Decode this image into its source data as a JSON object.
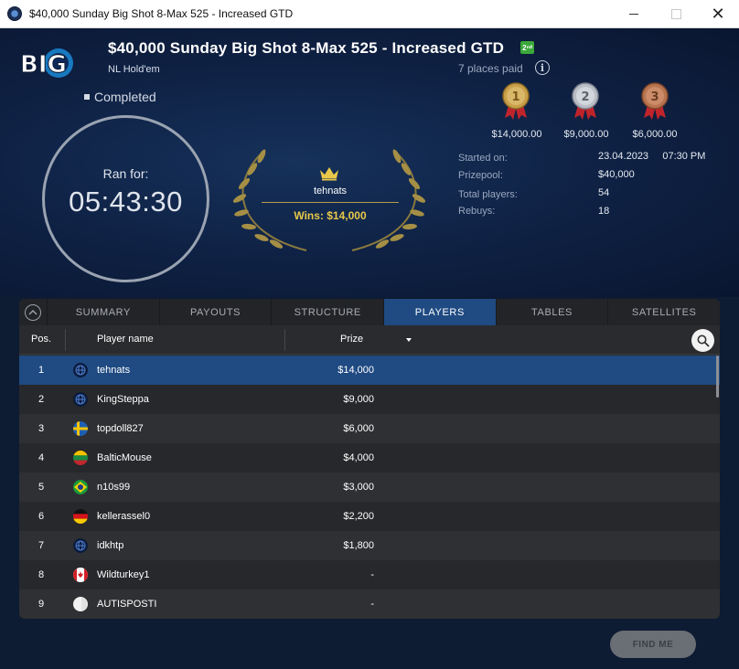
{
  "window": {
    "title": "$40,000 Sunday Big Shot 8-Max 525 - Increased GTD",
    "close_glyph": "✕"
  },
  "header": {
    "logo_text": "BIG",
    "title": "$40,000 Sunday Big Shot 8-Max 525 - Increased GTD",
    "badge": "2ⁿᵈ",
    "game_type": "NL Hold'em",
    "places_paid": "7 places paid",
    "info_glyph": "i",
    "status": "Completed",
    "ran_for_label": "Ran for:",
    "ran_for_time": "05:43:30",
    "winner": {
      "name": "tehnats",
      "prize": "Wins: $14,000"
    },
    "medals": [
      {
        "place": "1",
        "amount": "$14,000.00",
        "color": "#c9a04a"
      },
      {
        "place": "2",
        "amount": "$9,000.00",
        "color": "#b9bec6"
      },
      {
        "place": "3",
        "amount": "$6,000.00",
        "color": "#b8734f"
      }
    ],
    "stats": [
      {
        "label": "Started on:",
        "value": "23.04.2023     07:30 PM"
      },
      {
        "label": "Prizepool:",
        "value": "$40,000"
      },
      {
        "label": "Total players:",
        "value": "54"
      },
      {
        "label": "Rebuys:",
        "value": "18"
      }
    ]
  },
  "tabs": [
    {
      "label": "SUMMARY",
      "active": false
    },
    {
      "label": "PAYOUTS",
      "active": false
    },
    {
      "label": "STRUCTURE",
      "active": false
    },
    {
      "label": "PLAYERS",
      "active": true
    },
    {
      "label": "TABLES",
      "active": false
    },
    {
      "label": "SATELLITES",
      "active": false
    }
  ],
  "table": {
    "columns": {
      "pos": "Pos.",
      "name": "Player name",
      "prize": "Prize"
    },
    "rows": [
      {
        "pos": "1",
        "name": "tehnats",
        "prize": "$14,000",
        "flag": "globe",
        "selected": true
      },
      {
        "pos": "2",
        "name": "KingSteppa",
        "prize": "$9,000",
        "flag": "globe"
      },
      {
        "pos": "3",
        "name": "topdoll827",
        "prize": "$6,000",
        "flag": "sweden"
      },
      {
        "pos": "4",
        "name": "BalticMouse",
        "prize": "$4,000",
        "flag": "lithuania"
      },
      {
        "pos": "5",
        "name": "n10s99",
        "prize": "$3,000",
        "flag": "brazil"
      },
      {
        "pos": "6",
        "name": "kellerassel0",
        "prize": "$2,200",
        "flag": "germany"
      },
      {
        "pos": "7",
        "name": "idkhtp",
        "prize": "$1,800",
        "flag": "globe"
      },
      {
        "pos": "8",
        "name": "Wildturkey1",
        "prize": "-",
        "flag": "canada"
      },
      {
        "pos": "9",
        "name": "AUTISPOSTI",
        "prize": "-",
        "flag": "blank"
      }
    ]
  },
  "find_me_label": "FIND ME",
  "colors": {
    "accent": "#1f4a82",
    "gold": "#e8c84a",
    "panel": "#2a2b2e"
  }
}
